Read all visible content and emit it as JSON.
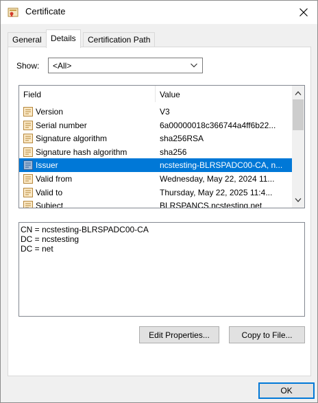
{
  "window": {
    "title": "Certificate"
  },
  "tabs": [
    {
      "label": "General",
      "active": false
    },
    {
      "label": "Details",
      "active": true
    },
    {
      "label": "Certification Path",
      "active": false
    }
  ],
  "show": {
    "label": "Show:",
    "selected": "<All>"
  },
  "list": {
    "columns": {
      "field": "Field",
      "value": "Value"
    },
    "rows": [
      {
        "field": "Version",
        "value": "V3"
      },
      {
        "field": "Serial number",
        "value": "6a00000018c366744a4ff6b22..."
      },
      {
        "field": "Signature algorithm",
        "value": "sha256RSA"
      },
      {
        "field": "Signature hash algorithm",
        "value": "sha256"
      },
      {
        "field": "Issuer",
        "value": "ncstesting-BLRSPADC00-CA, n...",
        "selected": true
      },
      {
        "field": "Valid from",
        "value": "Wednesday, May 22, 2024 11..."
      },
      {
        "field": "Valid to",
        "value": "Thursday, May 22, 2025 11:4..."
      },
      {
        "field": "Subject",
        "value": "BLRSPANCS.ncstesting.net"
      }
    ]
  },
  "detail": {
    "lines": [
      "CN = ncstesting-BLRSPADC00-CA",
      "DC = ncstesting",
      "DC = net"
    ]
  },
  "buttons": {
    "edit_properties": "Edit Properties...",
    "copy_to_file": "Copy to File...",
    "ok": "OK"
  },
  "colors": {
    "selection": "#0078d7",
    "window_bg": "#f0f0f0"
  }
}
